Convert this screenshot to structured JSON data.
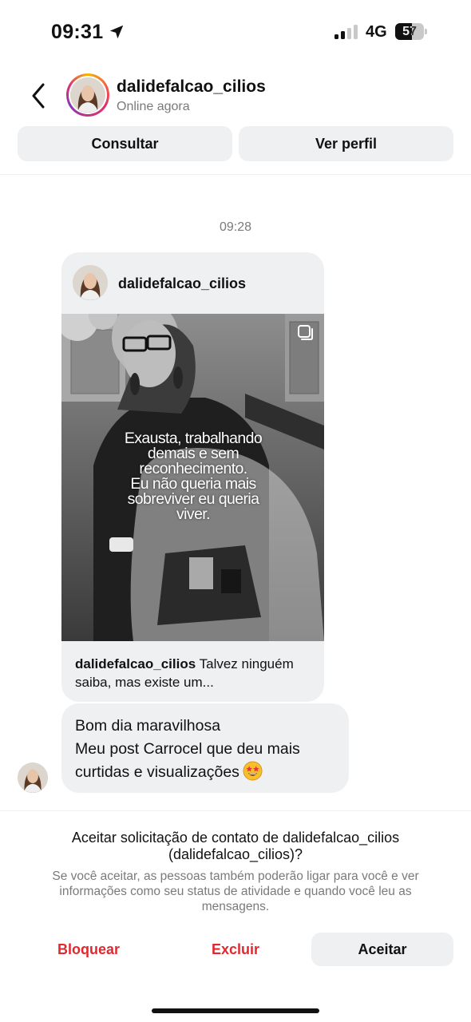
{
  "status_bar": {
    "time": "09:31",
    "network": "4G",
    "battery_level": "57"
  },
  "header": {
    "username": "dalidefalcao_cilios",
    "status": "Online agora",
    "consult_label": "Consultar",
    "profile_label": "Ver perfil"
  },
  "conversation": {
    "timestamp": "09:28",
    "shared_post": {
      "author": "dalidefalcao_cilios",
      "overlay_lines": [
        "Exausta, trabalhando",
        "demais e sem",
        "reconhecimento.",
        "Eu não queria mais",
        "sobreviver eu queria",
        "viver."
      ],
      "caption_author": "dalidefalcao_cilios",
      "caption_text": "Talvez ninguém saiba, mas existe um..."
    },
    "message": {
      "line1": "Bom dia maravilhosa",
      "line2": "Meu post Carrocel que deu mais",
      "line3": "curtidas e visualizações",
      "emoji": "star-struck-emoji"
    }
  },
  "request": {
    "title": "Aceitar solicitação de contato de dalidefalcao_cilios (dalidefalcao_cilios)?",
    "description": "Se você aceitar, as pessoas também poderão ligar para você e ver informações como seu status de atividade e quando você leu as mensagens.",
    "block_label": "Bloquear",
    "delete_label": "Excluir",
    "accept_label": "Aceitar"
  },
  "colors": {
    "danger": "#e0282f",
    "bubble": "#eef0f2",
    "secondary_text": "#7a7a7a"
  }
}
